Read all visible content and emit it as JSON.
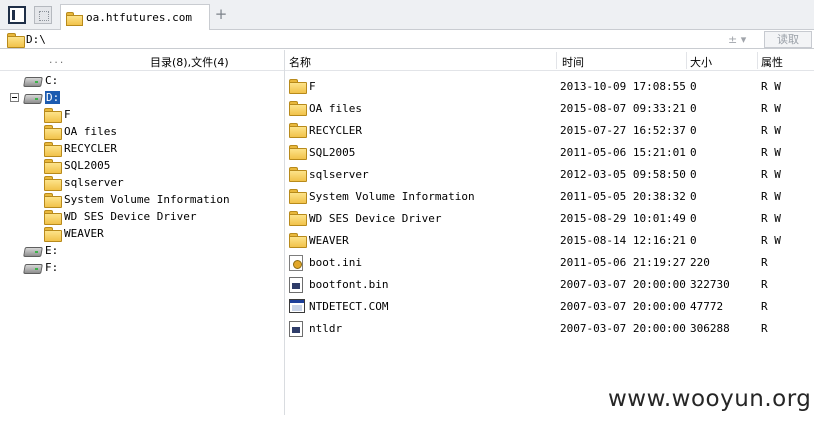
{
  "tab": {
    "title": "oa.htfutures.com",
    "new_tab_symbol": "+"
  },
  "address": {
    "path": "D:\\",
    "ctrl": "± ▾",
    "read_label": "读取"
  },
  "left_pane": {
    "dots": "...",
    "summary": "目录(8),文件(4)",
    "tree": [
      {
        "label": "C:",
        "type": "drive"
      },
      {
        "label": "D:",
        "type": "drive",
        "expanded": true,
        "selected": true
      },
      {
        "label": "F",
        "type": "folder"
      },
      {
        "label": "OA files",
        "type": "folder"
      },
      {
        "label": "RECYCLER",
        "type": "folder"
      },
      {
        "label": "SQL2005",
        "type": "folder"
      },
      {
        "label": "sqlserver",
        "type": "folder"
      },
      {
        "label": "System Volume Information",
        "type": "folder"
      },
      {
        "label": "WD SES Device Driver",
        "type": "folder"
      },
      {
        "label": "WEAVER",
        "type": "folder"
      },
      {
        "label": "E:",
        "type": "drive"
      },
      {
        "label": "F:",
        "type": "drive"
      }
    ]
  },
  "right_pane": {
    "columns": {
      "name": "名称",
      "time": "时间",
      "size": "大小",
      "attr": "属性"
    },
    "files": [
      {
        "name": "F",
        "time": "2013-10-09 17:08:55",
        "size": "0",
        "attr": "R W",
        "icon": "folder-icon"
      },
      {
        "name": "OA files",
        "time": "2015-08-07 09:33:21",
        "size": "0",
        "attr": "R W",
        "icon": "folder-icon"
      },
      {
        "name": "RECYCLER",
        "time": "2015-07-27 16:52:37",
        "size": "0",
        "attr": "R W",
        "icon": "folder-icon"
      },
      {
        "name": "SQL2005",
        "time": "2011-05-06 15:21:01",
        "size": "0",
        "attr": "R W",
        "icon": "folder-icon"
      },
      {
        "name": "sqlserver",
        "time": "2012-03-05 09:58:50",
        "size": "0",
        "attr": "R W",
        "icon": "folder-icon"
      },
      {
        "name": "System Volume Information",
        "time": "2011-05-05 20:38:32",
        "size": "0",
        "attr": "R W",
        "icon": "folder-icon"
      },
      {
        "name": "WD SES Device Driver",
        "time": "2015-08-29 10:01:49",
        "size": "0",
        "attr": "R W",
        "icon": "folder-icon"
      },
      {
        "name": "WEAVER",
        "time": "2015-08-14 12:16:21",
        "size": "0",
        "attr": "R W",
        "icon": "folder-icon"
      },
      {
        "name": "boot.ini",
        "time": "2011-05-06 21:19:27",
        "size": "220",
        "attr": "R",
        "icon": "ini-file-icon"
      },
      {
        "name": "bootfont.bin",
        "time": "2007-03-07 20:00:00",
        "size": "322730",
        "attr": "R",
        "icon": "bin-file-icon"
      },
      {
        "name": "NTDETECT.COM",
        "time": "2007-03-07 20:00:00",
        "size": "47772",
        "attr": "R",
        "icon": "com-file-icon"
      },
      {
        "name": "ntldr",
        "time": "2007-03-07 20:00:00",
        "size": "306288",
        "attr": "R",
        "icon": "bin-file-icon"
      }
    ]
  },
  "watermark": "www.wooyun.org",
  "colors": {
    "selection": "#1c5bb0",
    "folder": "#f1c24a",
    "border": "#c9ccd1"
  }
}
